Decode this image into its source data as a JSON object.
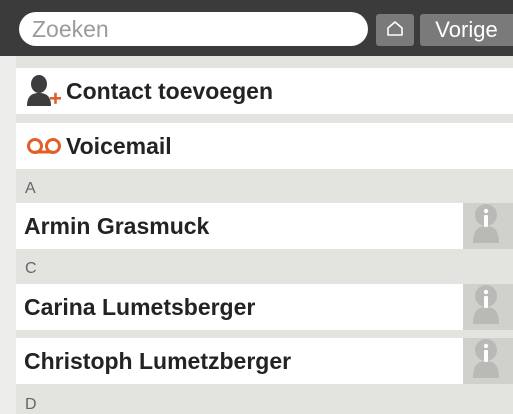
{
  "search": {
    "placeholder": "Zoeken"
  },
  "toolbar": {
    "home_icon": "home-icon",
    "back_label": "Vorige"
  },
  "actions": [
    {
      "label": "Contact toevoegen",
      "icon": "add-contact-icon",
      "accent": "#e0602a"
    },
    {
      "label": "Voicemail",
      "icon": "voicemail-icon",
      "accent": "#e0602a"
    }
  ],
  "sections": [
    {
      "letter": "A",
      "contacts": [
        {
          "name": "Armin Grasmuck"
        }
      ]
    },
    {
      "letter": "C",
      "contacts": [
        {
          "name": "Carina Lumetsberger"
        },
        {
          "name": "Christoph Lumetzberger"
        }
      ]
    },
    {
      "letter": "D",
      "contacts": []
    }
  ],
  "colors": {
    "topbar": "#3b3b3b",
    "button": "#7a7a7a",
    "background": "#e3e3e0",
    "info_button": "#d0d0cd",
    "accent": "#e0602a"
  }
}
